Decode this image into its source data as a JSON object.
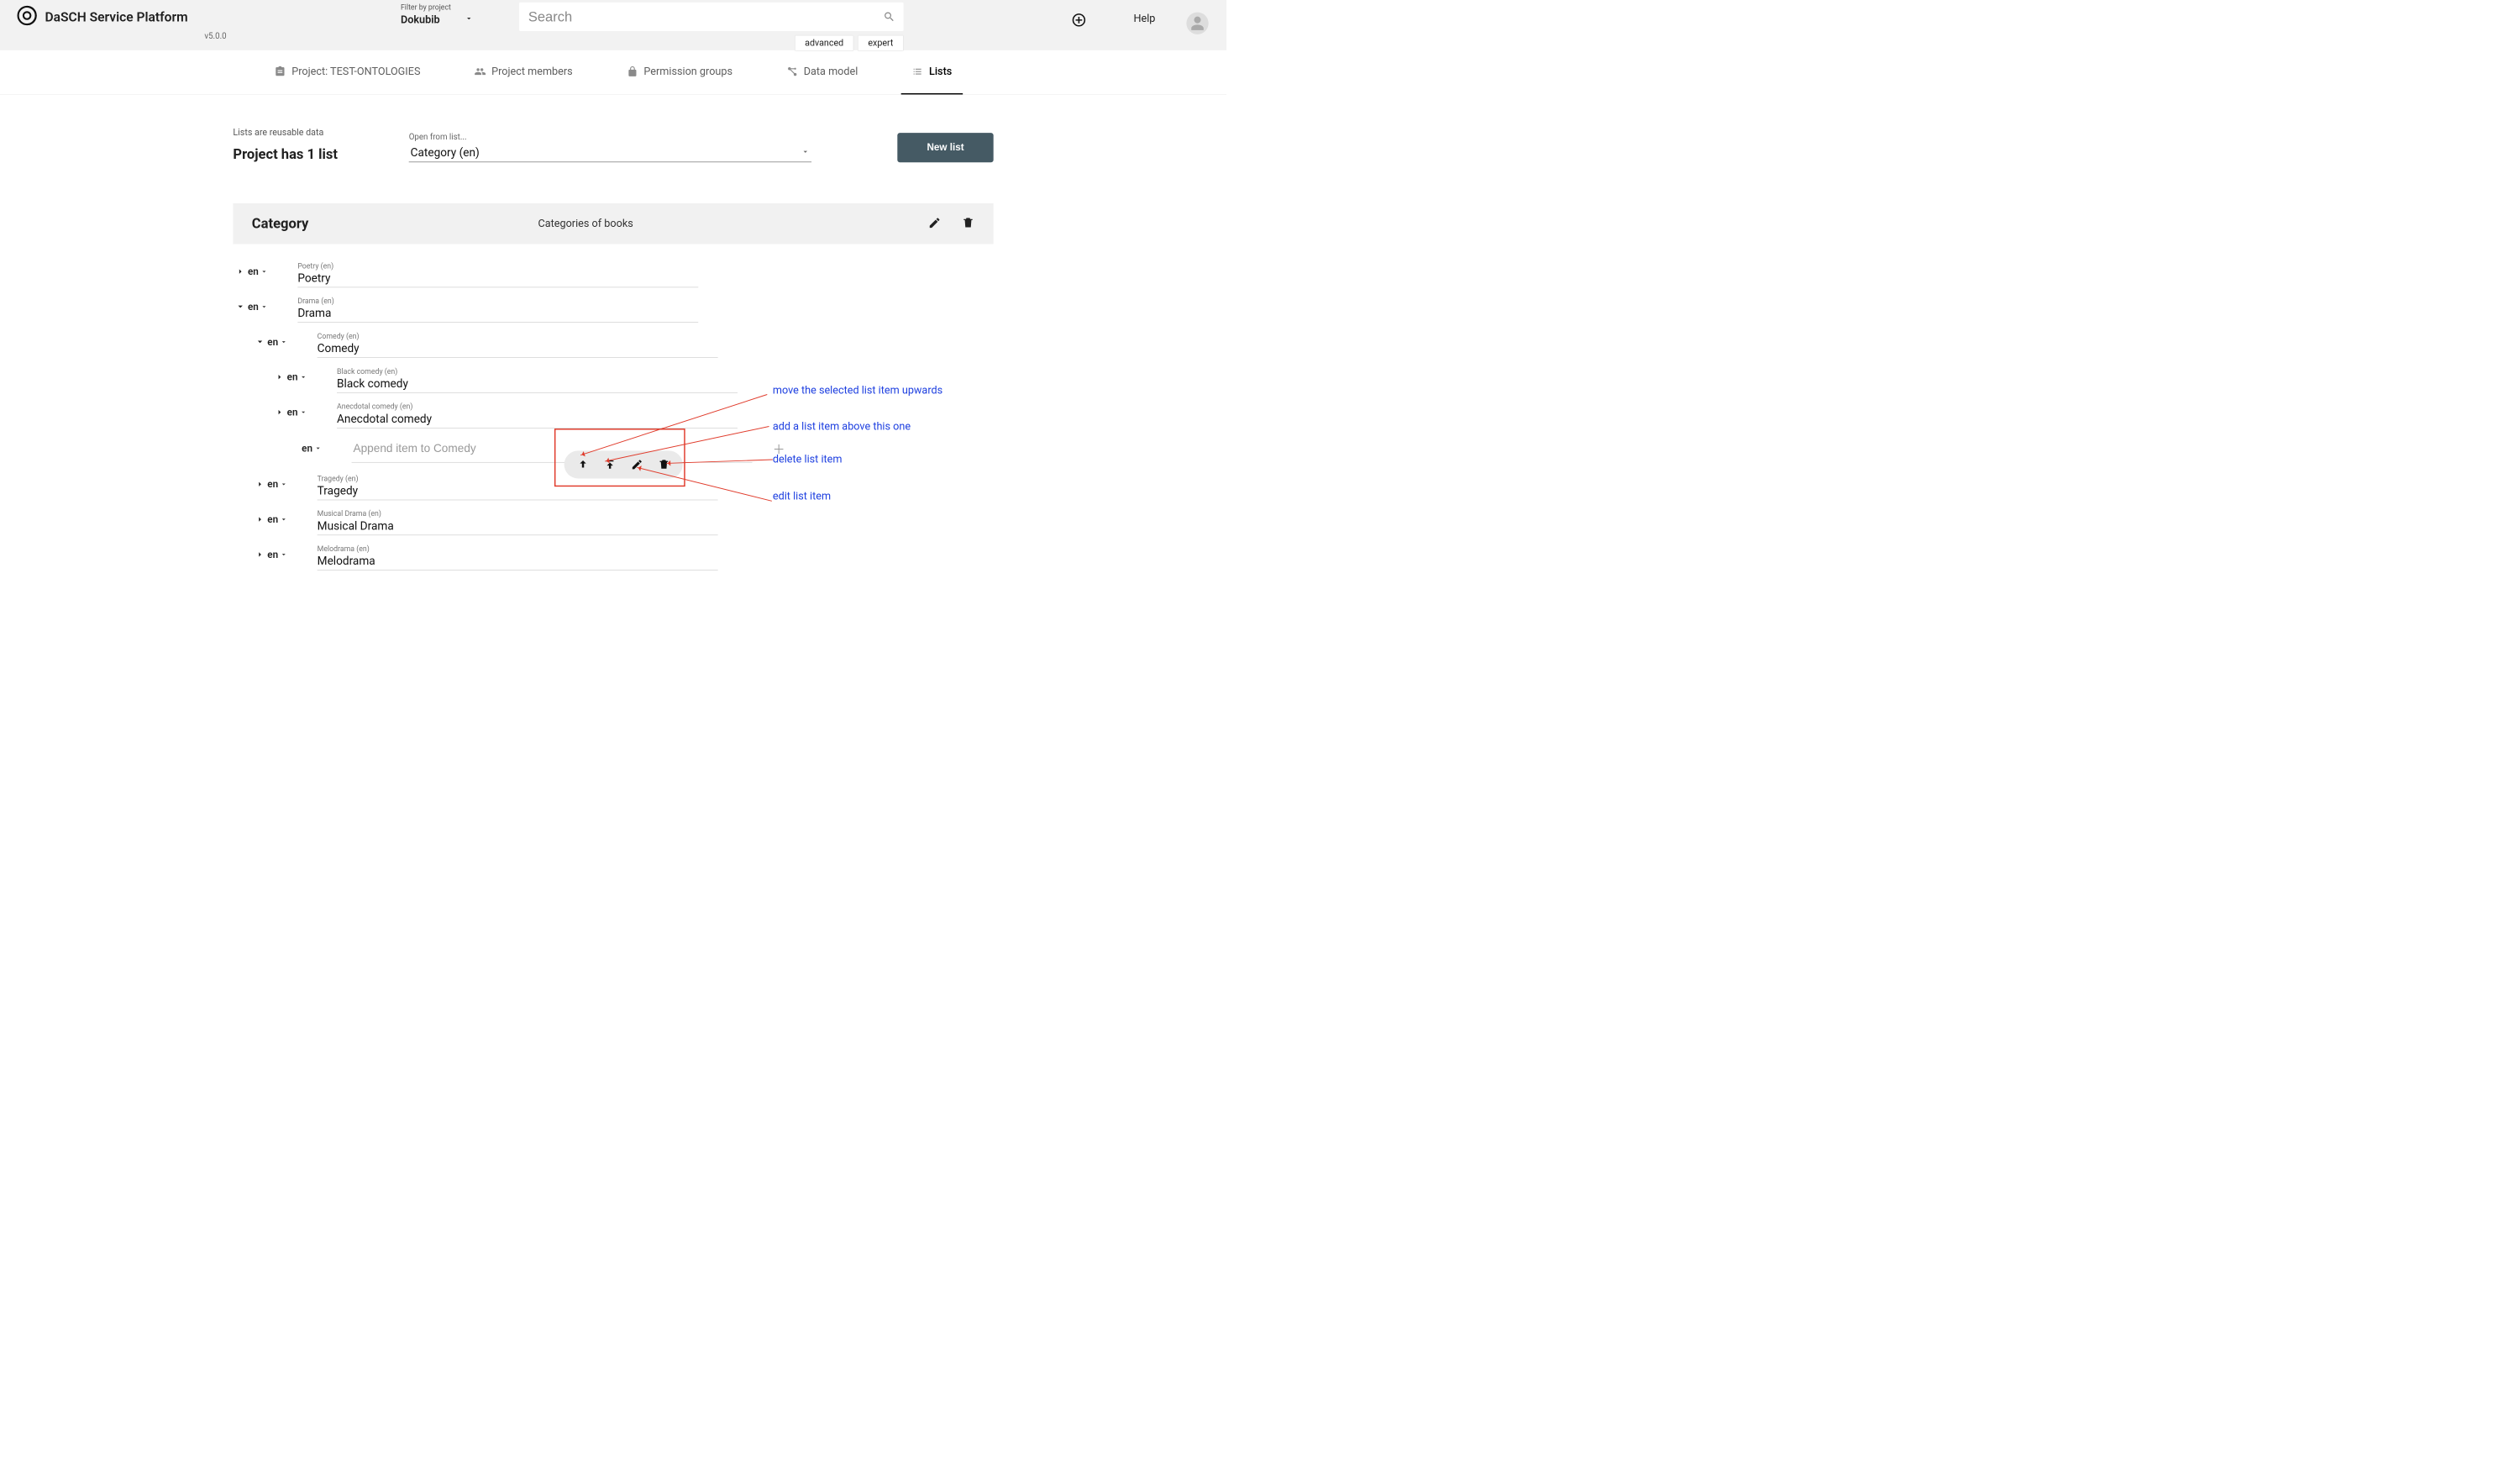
{
  "header": {
    "brand": "DaSCH Service Platform",
    "version": "v5.0.0",
    "filter_label": "Filter by project",
    "filter_value": "Dokubib",
    "search_placeholder": "Search",
    "mode_advanced": "advanced",
    "mode_expert": "expert",
    "help": "Help"
  },
  "tabs": {
    "project": "Project: TEST-ONTOLOGIES",
    "members": "Project members",
    "permissions": "Permission groups",
    "datamodel": "Data model",
    "lists": "Lists"
  },
  "lists": {
    "note": "Lists are reusable data",
    "title": "Project has 1 list",
    "open_label": "Open from list...",
    "open_value": "Category (en)",
    "newlist": "New list"
  },
  "panel": {
    "title": "Category",
    "subtitle": "Categories of books"
  },
  "lang": "en",
  "tree": {
    "poetry": {
      "caption": "Poetry (en)",
      "value": "Poetry"
    },
    "drama": {
      "caption": "Drama (en)",
      "value": "Drama"
    },
    "comedy": {
      "caption": "Comedy (en)",
      "value": "Comedy"
    },
    "blackc": {
      "caption": "Black comedy (en)",
      "value": "Black comedy"
    },
    "anec": {
      "caption": "Anecdotal comedy (en)",
      "value": "Anecdotal comedy"
    },
    "tragedy": {
      "caption": "Tragedy (en)",
      "value": "Tragedy"
    },
    "musical": {
      "caption": "Musical Drama (en)",
      "value": "Musical Drama"
    },
    "melo": {
      "caption": "Melodrama (en)",
      "value": "Melodrama"
    }
  },
  "append_placeholder": "Append item to Comedy",
  "annotations": {
    "move_up": "move the selected list item upwards",
    "add_above": "add a list item above this one",
    "delete": "delete list item",
    "edit": "edit list item"
  }
}
